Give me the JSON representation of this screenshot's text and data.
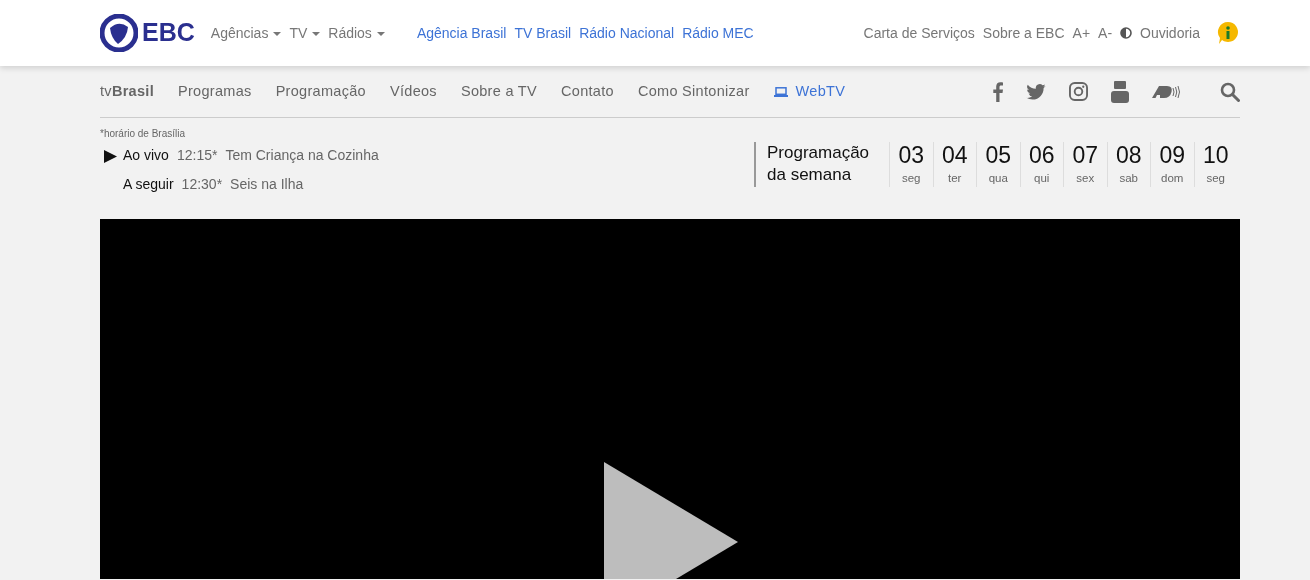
{
  "topbar": {
    "logo_text": "EBC",
    "dropdowns": [
      "Agências",
      "TV",
      "Rádios"
    ],
    "links": [
      "Agência Brasil",
      "TV Brasil",
      "Rádio Nacional",
      "Rádio MEC"
    ],
    "right_links": [
      {
        "label": "Carta de Serviços",
        "kind": "link"
      },
      {
        "label": "Sobre a EBC",
        "kind": "link"
      },
      {
        "label": "A+",
        "kind": "link"
      },
      {
        "label": "A-",
        "kind": "link"
      },
      {
        "kind": "contrast"
      },
      {
        "label": "Ouvidoria",
        "kind": "link"
      },
      {
        "kind": "info"
      }
    ]
  },
  "channel_nav": {
    "logo": "tv**Brasil**",
    "items": [
      {
        "label": "Programas",
        "selected": false
      },
      {
        "label": "Programação",
        "selected": false
      },
      {
        "label": "Vídeos",
        "selected": false
      },
      {
        "label": "Sobre a TV",
        "selected": false
      },
      {
        "label": "Contato",
        "selected": false
      },
      {
        "label": "Como Sintonizar",
        "selected": false
      },
      {
        "label": "WebTV",
        "selected": true
      }
    ],
    "social": [
      {
        "kind": "facebook"
      },
      {
        "kind": "twitter"
      },
      {
        "kind": "instagram"
      },
      {
        "kind": "youtube"
      },
      {
        "kind": "audio-description"
      }
    ]
  },
  "schedule": {
    "note": "*horário de Brasília",
    "now": [
      {
        "status": "Ao vivo",
        "time": "12:15*",
        "title": "Tem Criança na Cozinha",
        "playing": true
      },
      {
        "status": "A seguir",
        "time": "12:30*",
        "title": "Seis na Ilha",
        "playing": false
      }
    ],
    "week_title": "Programação da semana",
    "days": [
      {
        "day": "03",
        "weekday": "seg"
      },
      {
        "day": "04",
        "weekday": "ter"
      },
      {
        "day": "05",
        "weekday": "qua"
      },
      {
        "day": "06",
        "weekday": "qui"
      },
      {
        "day": "07",
        "weekday": "sex"
      },
      {
        "day": "08",
        "weekday": "sab"
      },
      {
        "day": "09",
        "weekday": "dom"
      },
      {
        "day": "10",
        "weekday": "seg"
      }
    ]
  },
  "player": {
    "kind": "video"
  }
}
